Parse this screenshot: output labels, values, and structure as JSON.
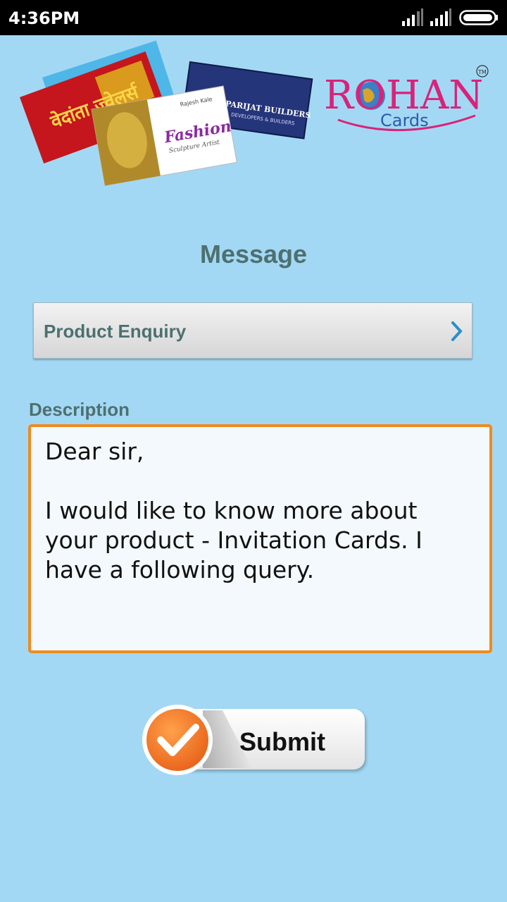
{
  "status_bar": {
    "time": "4:36PM"
  },
  "banner": {
    "logo_text": "ROHAN",
    "logo_subtext": "Cards",
    "trademark": "TM",
    "card_texts": {
      "red_card": "वेदांता ज्वेलर्स",
      "fashion_card_title": "Fashion",
      "fashion_card_subtitle": "Sculpture Artist",
      "fashion_card_name": "Rajesh Kale",
      "blue_card": "PARIJAT BUILDERS",
      "blue_card_sub": "DEVELOPERS & BUILDERS"
    }
  },
  "page_title": "Message",
  "subject": {
    "selected": "Product Enquiry"
  },
  "description": {
    "label": "Description",
    "value": "Dear sir,\n\nI would like to know more about your product - Invitation Cards. I have a following query."
  },
  "submit": {
    "label": "Submit"
  },
  "colors": {
    "background": "#a3d8f4",
    "accent_orange": "#f08a1c",
    "label_teal": "#4d7070",
    "logo_magenta": "#d8237a",
    "logo_blue": "#2a5caa"
  },
  "icons": [
    "signal-icon",
    "signal-icon",
    "battery-icon",
    "chevron-right-icon",
    "checkmark-icon"
  ]
}
